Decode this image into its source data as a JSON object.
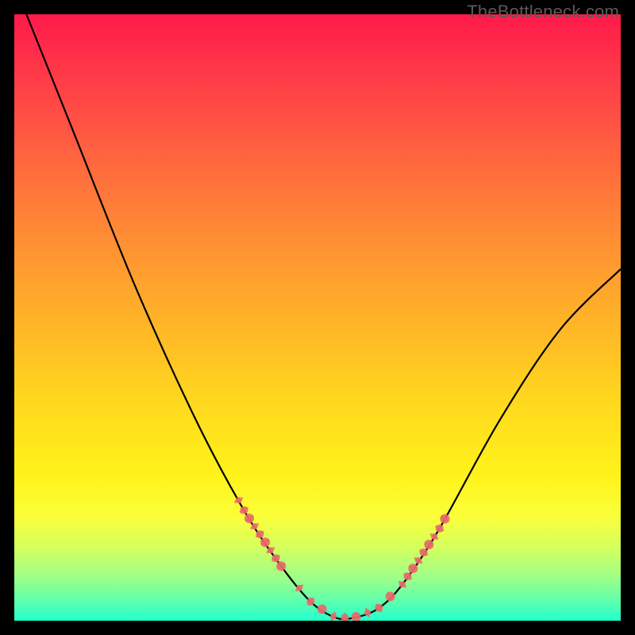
{
  "watermark": "TheBottleneck.com",
  "chart_data": {
    "type": "line",
    "title": "",
    "xlabel": "",
    "ylabel": "",
    "xlim": [
      0,
      100
    ],
    "ylim": [
      0,
      100
    ],
    "series": [
      {
        "name": "curve",
        "x": [
          2,
          10,
          20,
          30,
          38,
          44,
          49,
          53,
          56,
          60,
          64,
          70,
          80,
          90,
          100
        ],
        "y": [
          100,
          80,
          55,
          33,
          18,
          9,
          3,
          0.5,
          0.5,
          2,
          6,
          15,
          33,
          48,
          58
        ]
      }
    ],
    "markers": [
      {
        "name": "left-cluster",
        "x_range": [
          37,
          44
        ],
        "y_range": [
          7,
          21
        ]
      },
      {
        "name": "bottom-cluster",
        "x_range": [
          47,
          62
        ],
        "y_range": [
          0,
          4
        ]
      },
      {
        "name": "right-cluster",
        "x_range": [
          64,
          71
        ],
        "y_range": [
          8,
          20
        ]
      }
    ],
    "marker_color": "#e86a6a",
    "curve_color": "#000000",
    "gradient_stops": [
      {
        "pos": 0,
        "color": "#ff1a4a"
      },
      {
        "pos": 50,
        "color": "#ffb228"
      },
      {
        "pos": 80,
        "color": "#fff31a"
      },
      {
        "pos": 100,
        "color": "#22ffcf"
      }
    ]
  }
}
